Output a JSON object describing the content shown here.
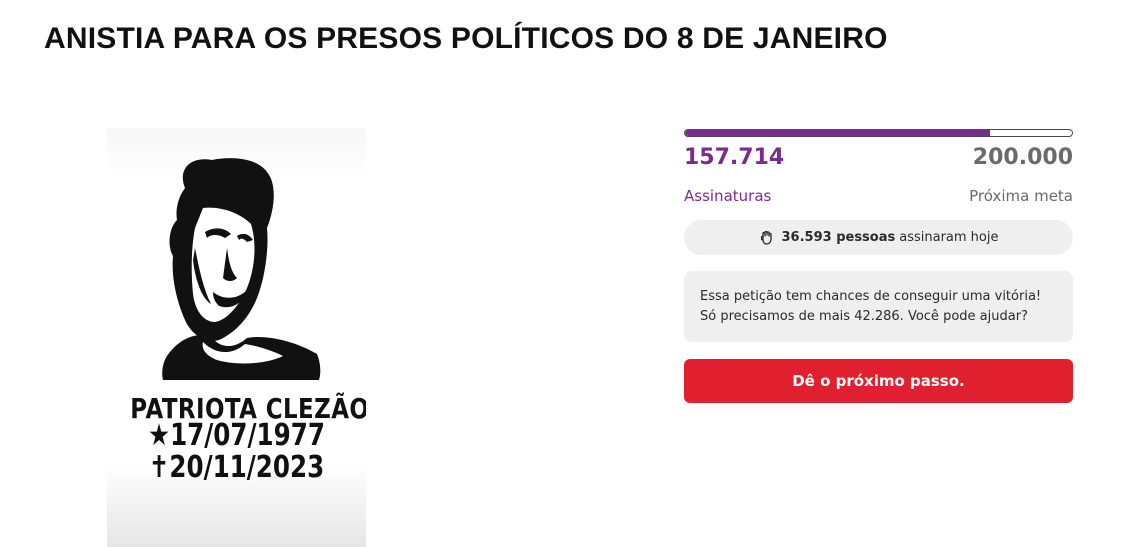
{
  "petition": {
    "title": "ANISTIA PARA OS PRESOS POLÍTICOS DO 8 DE JANEIRO"
  },
  "image": {
    "caption_name": "PATRIOTA CLEZÃO",
    "caption_birth": "★17/07/1977",
    "caption_death": "✝20/11/2023"
  },
  "progress": {
    "fraction": 0.7886,
    "signatures": "157.714",
    "signatures_label": "Assinaturas",
    "goal": "200.000",
    "goal_label": "Próxima meta",
    "fill_color": "#7b2a91"
  },
  "today": {
    "icon": "raised-fist-icon",
    "count": "36.593 pessoas",
    "text": "assinaram hoje"
  },
  "info": {
    "line1": "Essa petição tem chances de conseguir uma vitória!",
    "line2": "Só precisamos de mais 42.286. Você pode ajudar?"
  },
  "cta": {
    "label": "Dê o próximo passo.",
    "color": "#e0202e"
  }
}
